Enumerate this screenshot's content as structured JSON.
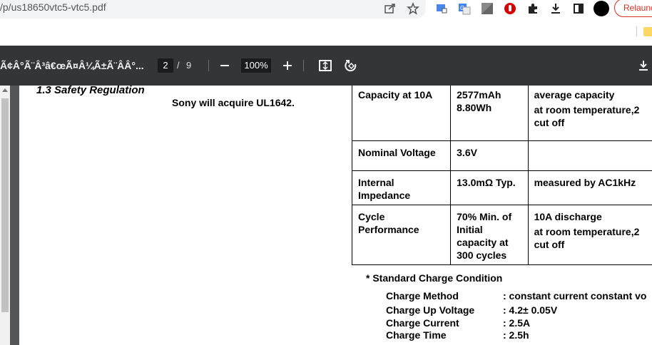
{
  "browser": {
    "url": "/p/us18650vtc5-vtc5.pdf",
    "relaunch_label": "Relaunch",
    "icons": [
      "share-icon",
      "star-icon",
      "extension-icon",
      "translate-icon",
      "extension-icon",
      "shield-extension-icon",
      "puzzle-icon",
      "download-icon",
      "sidebar-icon",
      "profile-icon"
    ]
  },
  "pdf_toolbar": {
    "title": "Ã¢Â°Ã¨Â³â€œÃ¤Â¼Ã±Ã¨ÂÂ°...",
    "current_page": "2",
    "page_separator": "/",
    "total_pages": "9",
    "zoom": "100%"
  },
  "document": {
    "section_heading": "1.3 Safety Regulation",
    "safety_text": "Sony will acquire UL1642.",
    "table": [
      {
        "param": [
          "Capacity at 10A"
        ],
        "value": [
          "2577mAh",
          "8.80Wh"
        ],
        "note": [
          "average capacity",
          "at room temperature,2",
          "cut off"
        ]
      },
      {
        "param": [
          "Nominal Voltage"
        ],
        "value": [
          "3.6V"
        ],
        "note": [
          ""
        ]
      },
      {
        "param": [
          "Internal",
          "Impedance"
        ],
        "value": [
          "13.0mΩ Typ."
        ],
        "note": [
          "measured by AC1kHz"
        ]
      },
      {
        "param": [
          "Cycle",
          "Performance"
        ],
        "value": [
          "70%  Min. of",
          "Initial",
          "capacity at",
          "300 cycles"
        ],
        "note": [
          "10A discharge",
          "at room temperature,2",
          "cut off"
        ]
      }
    ],
    "charge_title": "* Standard Charge Condition",
    "charge_conditions": [
      {
        "label": "Charge Method",
        "value": ": constant current constant vo"
      },
      {
        "label": "Charge Up Voltage",
        "value": ": 4.2± 0.05V"
      },
      {
        "label": "Charge Current",
        "value": ": 2.5A"
      },
      {
        "label": "Charge Time",
        "value": ": 2.5h"
      }
    ]
  }
}
